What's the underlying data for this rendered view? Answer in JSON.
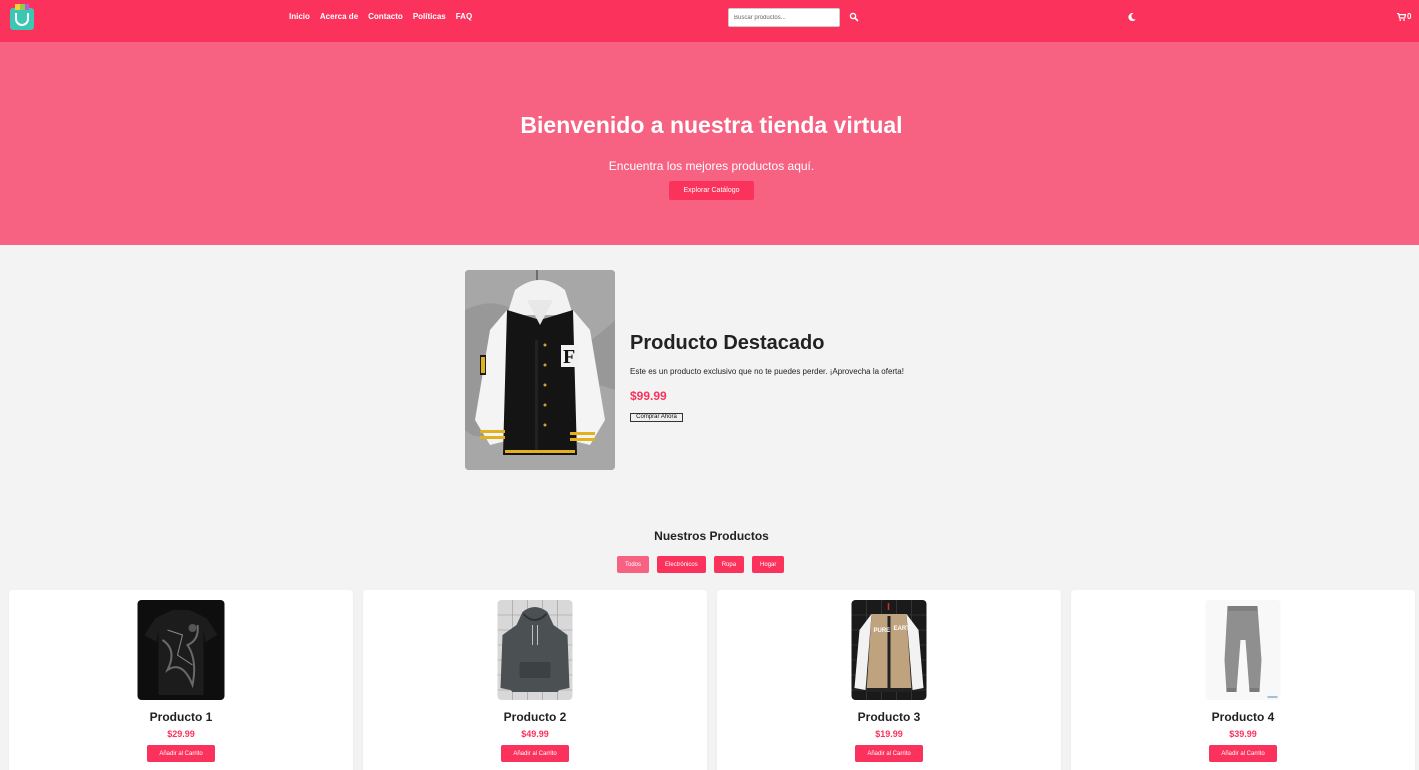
{
  "header": {
    "logo_icon": "shopping-bag-icon",
    "nav": [
      "Inicio",
      "Acerca de",
      "Contacto",
      "Políticas",
      "FAQ"
    ],
    "search_placeholder": "Buscar productos...",
    "search_icon": "search-icon",
    "theme_icon": "moon-icon",
    "cart_icon": "cart-icon",
    "cart_count": "0"
  },
  "hero": {
    "title": "Bienvenido a nuestra tienda virtual",
    "subtitle": "Encuentra los mejores productos aquí.",
    "button": "Explorar Catálogo"
  },
  "featured": {
    "title": "Producto Destacado",
    "description": "Este es un producto exclusivo que no te puedes perder. ¡Aprovecha la oferta!",
    "price": "$99.99",
    "button": "Comprar Ahora"
  },
  "products": {
    "title": "Nuestros Productos",
    "filters": [
      "Todos",
      "Electrónicos",
      "Ropa",
      "Hogar"
    ],
    "active_filter": "Todos",
    "items": [
      {
        "name": "Producto 1",
        "price": "$29.99",
        "button": "Añadir al Carrito"
      },
      {
        "name": "Producto 2",
        "price": "$49.99",
        "button": "Añadir al Carrito"
      },
      {
        "name": "Producto 3",
        "price": "$19.99",
        "button": "Añadir al Carrito"
      },
      {
        "name": "Producto 4",
        "price": "$39.99",
        "button": "Añadir al Carrito"
      }
    ]
  },
  "colors": {
    "primary": "#fa325c",
    "hero_bg": "#f76283",
    "page_bg": "#f3f3f3"
  }
}
